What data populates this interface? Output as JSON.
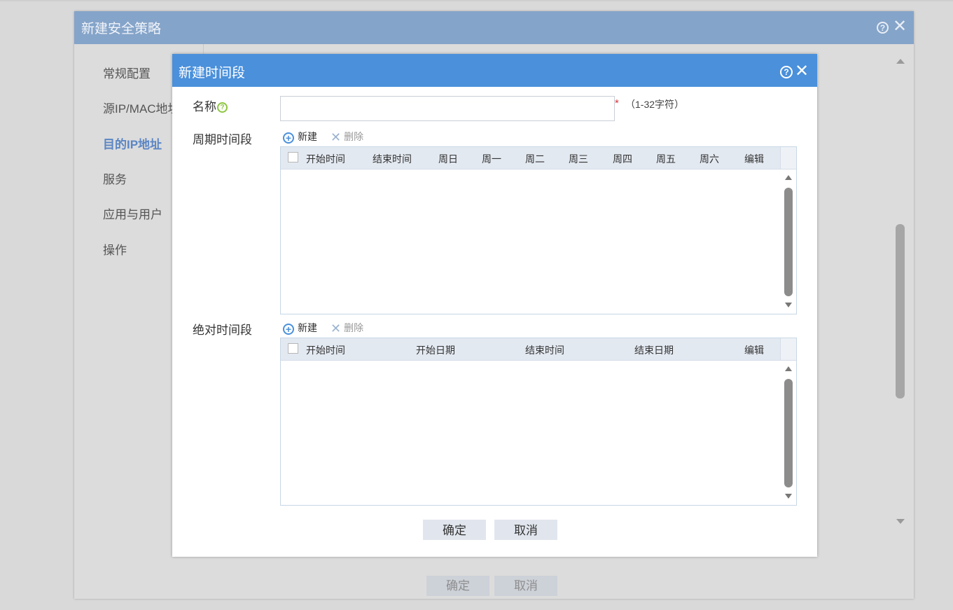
{
  "outer_dialog": {
    "title": "新建安全策略",
    "help_icon": "question-circle-icon",
    "close_icon": "close-icon",
    "nav": [
      {
        "label": "常规配置",
        "active": false
      },
      {
        "label": "源IP/MAC地址",
        "active": false
      },
      {
        "label": "目的IP地址",
        "active": true
      },
      {
        "label": "服务",
        "active": false
      },
      {
        "label": "应用与用户",
        "active": false
      },
      {
        "label": "操作",
        "active": false
      }
    ],
    "ok_label": "确定",
    "cancel_label": "取消"
  },
  "dialog": {
    "title": "新建时间段",
    "help_icon": "question-circle-icon",
    "close_icon": "close-icon",
    "name_label": "名称",
    "name_value": "",
    "name_required": "*",
    "name_hint": "（1-32字符）",
    "periodic": {
      "label": "周期时间段",
      "add_label": "新建",
      "delete_label": "删除",
      "columns": [
        "开始时间",
        "结束时间",
        "周日",
        "周一",
        "周二",
        "周三",
        "周四",
        "周五",
        "周六",
        "编辑"
      ],
      "rows": []
    },
    "absolute": {
      "label": "绝对时间段",
      "add_label": "新建",
      "delete_label": "删除",
      "columns": [
        "开始时间",
        "开始日期",
        "结束时间",
        "结束日期",
        "编辑"
      ],
      "rows": []
    },
    "ok_label": "确定",
    "cancel_label": "取消"
  },
  "colors": {
    "dialog_header": "#4a90db",
    "outer_header": "#85a4c9",
    "active_nav": "#5b86c4",
    "required": "#d9363e",
    "help_green": "#8cc63f"
  }
}
